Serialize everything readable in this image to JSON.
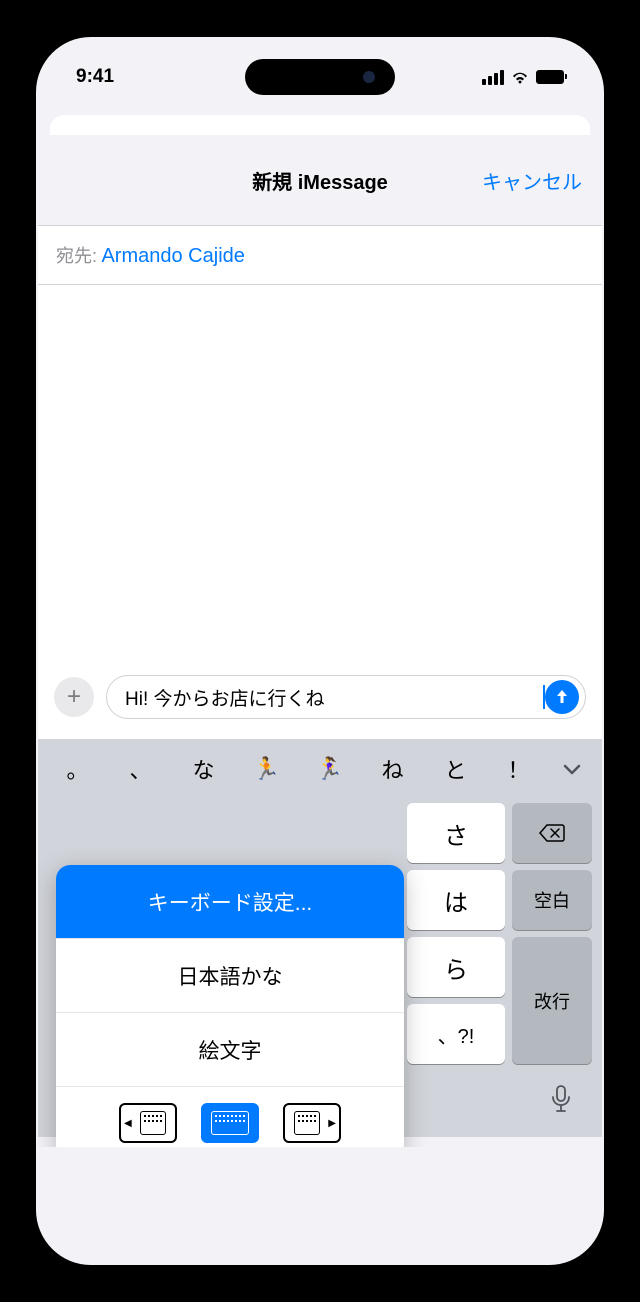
{
  "status": {
    "time": "9:41"
  },
  "nav": {
    "title": "新規 iMessage",
    "cancel": "キャンセル"
  },
  "recipient": {
    "label": "宛先:",
    "name": "Armando Cajide"
  },
  "compose": {
    "text": "Hi! 今からお店に行くね"
  },
  "suggestions": [
    "。",
    "、",
    "な",
    "🏃",
    "🏃‍♀️",
    "ね",
    "と",
    "！"
  ],
  "keys": {
    "col_right1": [
      "さ",
      "は",
      "ら",
      "、?!"
    ],
    "backspace": "⌫",
    "space": "空白",
    "return": "改行"
  },
  "popup": {
    "settings": "キーボード設定...",
    "kana": "日本語かな",
    "emoji": "絵文字"
  }
}
